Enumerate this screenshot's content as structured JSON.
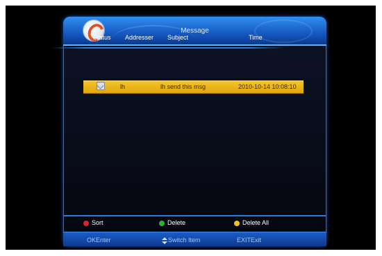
{
  "title": "Message",
  "columns": {
    "status": "Status",
    "addresser": "Addresser",
    "subject": "Subject",
    "time": "Time"
  },
  "messages": [
    {
      "status_icon": "envelope-icon",
      "addresser": "lh",
      "subject": "lh send this msg",
      "time": "2010-10-14 10:08:10"
    }
  ],
  "color_keys": [
    {
      "label": "Sort",
      "color": "#d9262b"
    },
    {
      "label": "Delete",
      "color": "#2fae36"
    },
    {
      "label": "Delete All",
      "color": "#f0c320"
    }
  ],
  "nav_hints": [
    {
      "key": "OK",
      "label": "Enter"
    },
    {
      "key": "",
      "label": "Switch Item",
      "icon": "up-down-arrows-icon"
    },
    {
      "key": "EXIT",
      "label": "Exit"
    }
  ]
}
